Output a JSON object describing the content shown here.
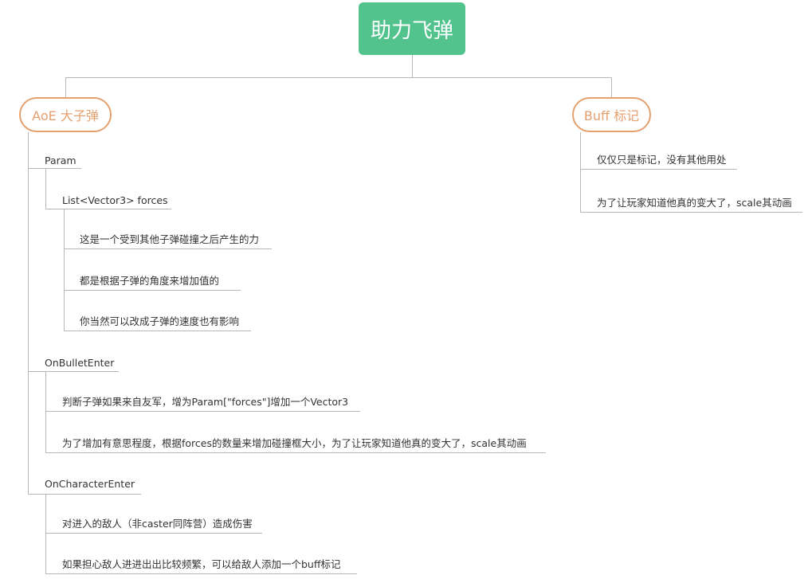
{
  "root": {
    "label": "助力飞弹"
  },
  "branches": [
    {
      "label": "AoE 大子弹",
      "children": [
        {
          "label": "Param",
          "children": [
            {
              "label": "List<Vector3> forces",
              "children": [
                {
                  "label": "这是一个受到其他子弹碰撞之后产生的力"
                },
                {
                  "label": "都是根据子弹的角度来增加值的"
                },
                {
                  "label": "你当然可以改成子弹的速度也有影响"
                }
              ]
            }
          ]
        },
        {
          "label": "OnBulletEnter",
          "children": [
            {
              "label": "判断子弹如果来自友军，增为Param[\"forces\"]增加一个Vector3"
            },
            {
              "label": "为了增加有意思程度，根据forces的数量来增加碰撞框大小，为了让玩家知道他真的变大了，scale其动画"
            }
          ]
        },
        {
          "label": "OnCharacterEnter",
          "children": [
            {
              "label": "对进入的敌人（非caster同阵营）造成伤害"
            },
            {
              "label": "如果担心敌人进进出出比较频繁，可以给敌人添加一个buff标记"
            }
          ]
        }
      ]
    },
    {
      "label": "Buff 标记",
      "children": [
        {
          "label": "仅仅只是标记，没有其他用处"
        },
        {
          "label": "为了让玩家知道他真的变大了，scale其动画"
        }
      ]
    }
  ],
  "colors": {
    "root_fill": "#52c38c",
    "branch_border": "#e5a070",
    "branch_text": "#e5a070",
    "connector": "#b7b7b7",
    "leaf_text": "#333333"
  }
}
